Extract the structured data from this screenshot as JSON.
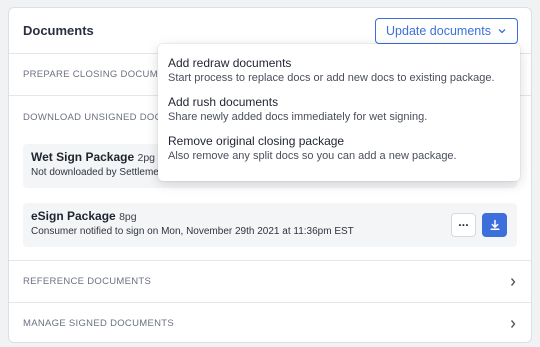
{
  "header": {
    "title": "Documents",
    "update_button_label": "Update documents"
  },
  "sections": {
    "prepare": "PREPARE CLOSING DOCUMENTS",
    "download": "DOWNLOAD UNSIGNED DOCUMENTS",
    "reference": "REFERENCE DOCUMENTS",
    "manage": "MANAGE SIGNED DOCUMENTS"
  },
  "packages": [
    {
      "name": "Wet Sign Package",
      "pages": "2pg",
      "status": "Not downloaded by Settlement agent"
    },
    {
      "name": "eSign Package",
      "pages": "8pg",
      "status": "Consumer notified to sign on Mon, November 29th 2021 at 11:36pm EST",
      "more_label": "···"
    }
  ],
  "dropdown": {
    "items": [
      {
        "title": "Add redraw documents",
        "description": "Start process to replace docs or add new docs to existing package."
      },
      {
        "title": "Add rush documents",
        "description": "Share newly added docs immediately for wet signing."
      },
      {
        "title": "Remove original closing package",
        "description": "Also remove any split docs so you can add a new package."
      }
    ]
  },
  "colors": {
    "accent": "#3c6fdc",
    "background": "#f1f2f4",
    "card": "#ffffff"
  },
  "icons": [
    "chevron-down-icon",
    "chevron-right-icon",
    "more-icon",
    "download-icon"
  ]
}
